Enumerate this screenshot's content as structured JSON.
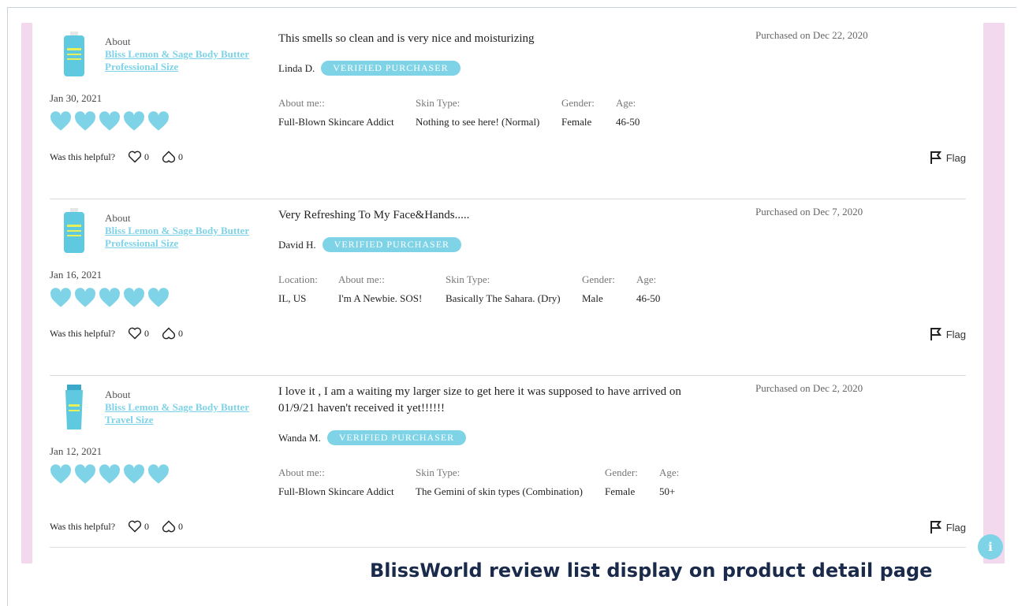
{
  "caption": "BlissWorld review list display on product detail page",
  "colors": {
    "accent": "#7fd3e6",
    "stripe": "#f3d9ee",
    "caption": "#1a2a4a"
  },
  "info_button": {
    "label": "i",
    "icon": "info-icon"
  },
  "labels": {
    "about": "About",
    "verified": "VERIFIED PURCHASER",
    "helpful": "Was this helpful?",
    "flag": "Flag"
  },
  "reviews": [
    {
      "product_line1": "Bliss Lemon & Sage Body Butter",
      "product_line2": "Professional Size",
      "date": "Jan 30, 2021",
      "rating": 5,
      "headline": "This smells so clean and is very nice and moisturizing",
      "reviewer": "Linda D.",
      "purchased": "Purchased on Dec 22, 2020",
      "attrs": [
        {
          "label": "About me::",
          "value": "Full-Blown Skincare Addict"
        },
        {
          "label": "Skin Type:",
          "value": "Nothing to see here! (Normal)"
        },
        {
          "label": "Gender:",
          "value": "Female"
        },
        {
          "label": "Age:",
          "value": "46-50"
        }
      ],
      "likes": "0",
      "dislikes": "0"
    },
    {
      "product_line1": "Bliss Lemon & Sage Body Butter",
      "product_line2": "Professional Size",
      "date": "Jan 16, 2021",
      "rating": 5,
      "headline": "Very Refreshing To My Face&Hands.....",
      "reviewer": "David H.",
      "purchased": "Purchased on Dec 7, 2020",
      "attrs": [
        {
          "label": "Location:",
          "value": "IL, US"
        },
        {
          "label": "About me::",
          "value": "I'm A Newbie. SOS!"
        },
        {
          "label": "Skin Type:",
          "value": "Basically The Sahara. (Dry)"
        },
        {
          "label": "Gender:",
          "value": "Male"
        },
        {
          "label": "Age:",
          "value": "46-50"
        }
      ],
      "likes": "0",
      "dislikes": "0"
    },
    {
      "product_line1": "Bliss Lemon & Sage Body Butter",
      "product_line2": "Travel Size",
      "date": "Jan 12, 2021",
      "rating": 5,
      "headline": "I love it , I am a waiting my larger size to get here it was supposed to have arrived on 01/9/21 haven't received it yet!!!!!!",
      "reviewer": "Wanda M.",
      "purchased": "Purchased on Dec 2, 2020",
      "attrs": [
        {
          "label": "About me::",
          "value": "Full-Blown Skincare Addict"
        },
        {
          "label": "Skin Type:",
          "value": "The Gemini of skin types (Combination)"
        },
        {
          "label": "Gender:",
          "value": "Female"
        },
        {
          "label": "Age:",
          "value": "50+"
        }
      ],
      "likes": "0",
      "dislikes": "0"
    }
  ]
}
